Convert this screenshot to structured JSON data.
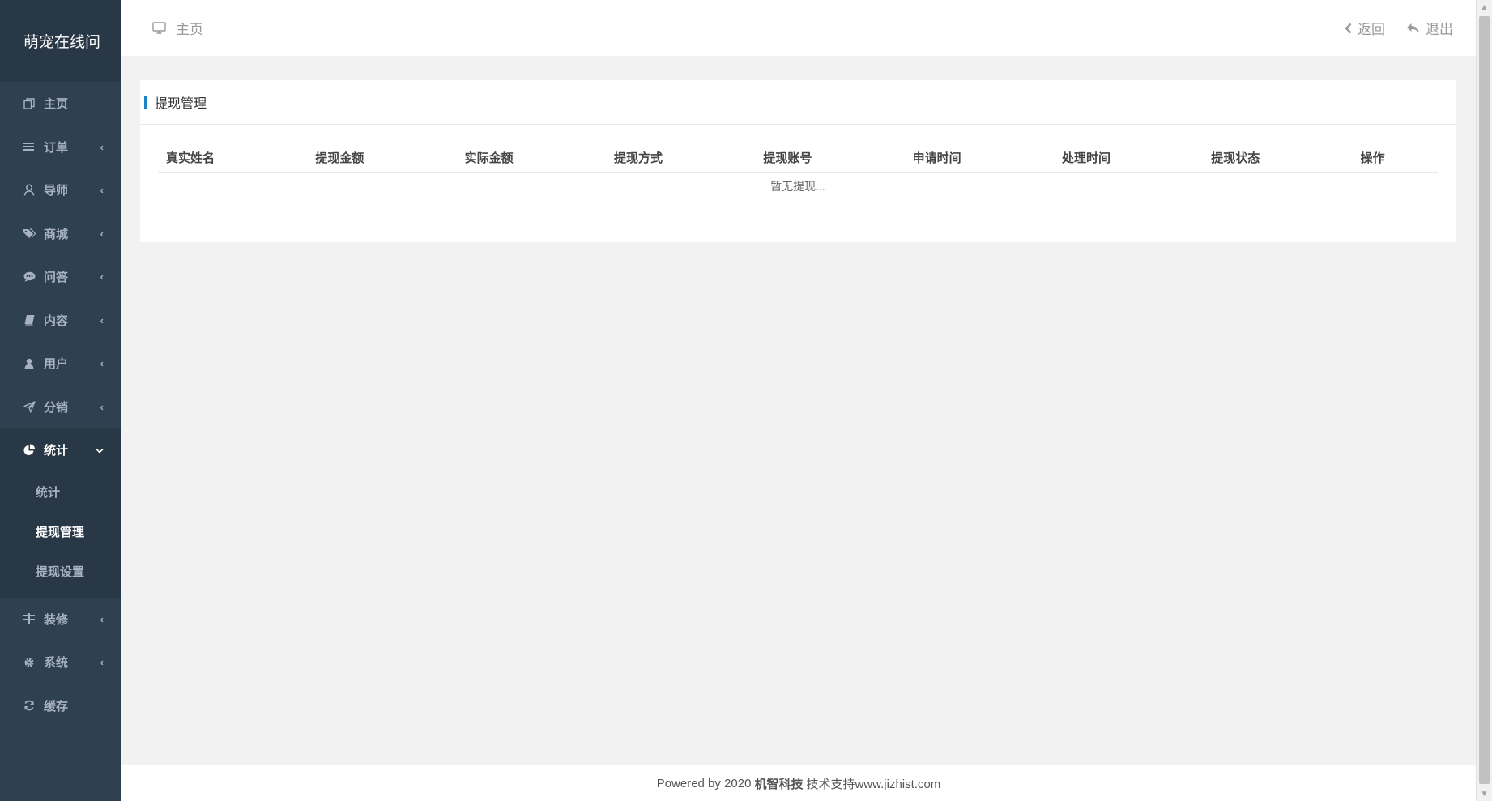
{
  "sidebar": {
    "brand": "萌宠在线问",
    "items": [
      {
        "label": "主页",
        "icon": "copy-icon",
        "chevron": ""
      },
      {
        "label": "订单",
        "icon": "bars-icon",
        "chevron": "‹"
      },
      {
        "label": "导师",
        "icon": "user-outline-icon",
        "chevron": "‹"
      },
      {
        "label": "商城",
        "icon": "tags-icon",
        "chevron": "‹"
      },
      {
        "label": "问答",
        "icon": "comment-icon",
        "chevron": "‹"
      },
      {
        "label": "内容",
        "icon": "book-icon",
        "chevron": "‹"
      },
      {
        "label": "用户",
        "icon": "user-icon",
        "chevron": "‹"
      },
      {
        "label": "分销",
        "icon": "paper-plane-icon",
        "chevron": "‹"
      },
      {
        "label": "统计",
        "icon": "pie-chart-icon",
        "chevron": "⌄"
      }
    ],
    "submenu": [
      {
        "label": "统计"
      },
      {
        "label": "提现管理"
      },
      {
        "label": "提现设置"
      }
    ],
    "items_after": [
      {
        "label": "装修",
        "icon": "sliders-icon",
        "chevron": "‹"
      },
      {
        "label": "系统",
        "icon": "gear-icon",
        "chevron": "‹"
      },
      {
        "label": "缓存",
        "icon": "refresh-icon",
        "chevron": ""
      }
    ]
  },
  "topbar": {
    "breadcrumb": "主页",
    "back_label": "返回",
    "logout_label": "退出"
  },
  "panel": {
    "title": "提现管理",
    "columns": [
      "真实姓名",
      "提现金额",
      "实际金额",
      "提现方式",
      "提现账号",
      "申请时间",
      "处理时间",
      "提现状态",
      "操作"
    ],
    "empty_text": "暂无提现..."
  },
  "footer": {
    "prefix": "Powered by 2020",
    "company": "机智科技",
    "suffix": "技术支持www.jizhist.com"
  },
  "colors": {
    "sidebar_bg": "#2f4050",
    "sidebar_active_bg": "#293846",
    "accent": "#1c84c6",
    "page_bg": "#f2f2f2"
  }
}
